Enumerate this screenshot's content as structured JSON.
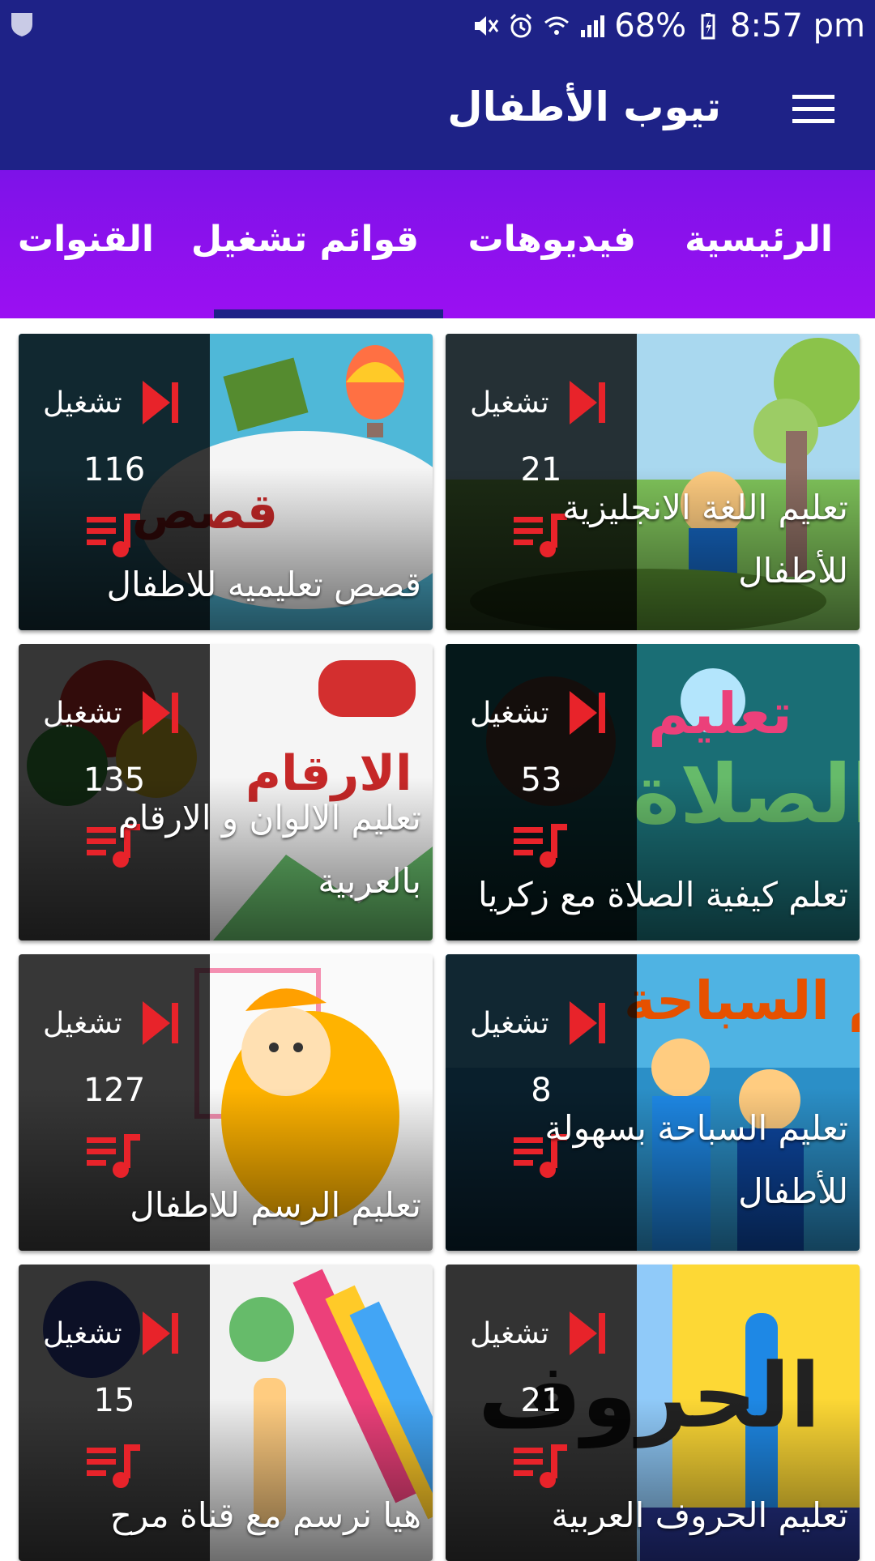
{
  "status_bar": {
    "battery": "68%",
    "time": "8:57 pm",
    "icons": [
      "shield-icon",
      "mute-icon",
      "alarm-icon",
      "wifi-call-icon",
      "signal-icon",
      "battery-icon"
    ]
  },
  "app_bar": {
    "title": "تيوب الأطفال",
    "menu_icon": "hamburger-menu-icon"
  },
  "tabs": [
    {
      "label": "الرئيسية",
      "selected": false
    },
    {
      "label": "فيديوهات",
      "selected": false
    },
    {
      "label": "قوائم تشغيل",
      "selected": true
    },
    {
      "label": "القنوات",
      "selected": false
    }
  ],
  "colors": {
    "primary": "#1e2287",
    "tab_bg": "#9b10f2",
    "accent_red": "#e8232a"
  },
  "playlists": [
    {
      "title": "تعليم اللغة الانجليزية للأطفال",
      "count": "21",
      "play_label": "تشغيل"
    },
    {
      "title": "قصص تعليميه للاطفال",
      "count": "116",
      "play_label": "تشغيل"
    },
    {
      "title": "تعلم كيفية الصلاة مع زكريا",
      "count": "53",
      "play_label": "تشغيل"
    },
    {
      "title": "تعليم الالوان و الارقام بالعربية",
      "count": "135",
      "play_label": "تشغيل"
    },
    {
      "title": "تعليم السباحة بسهولة للأطفال",
      "count": "8",
      "play_label": "تشغيل"
    },
    {
      "title": "تعليم الرسم للاطفال",
      "count": "127",
      "play_label": "تشغيل"
    },
    {
      "title": "تعليم الحروف العربية",
      "count": "21",
      "play_label": "تشغيل"
    },
    {
      "title": "هيا نرسم مع قناة مرح",
      "count": "15",
      "play_label": "تشغيل"
    }
  ]
}
